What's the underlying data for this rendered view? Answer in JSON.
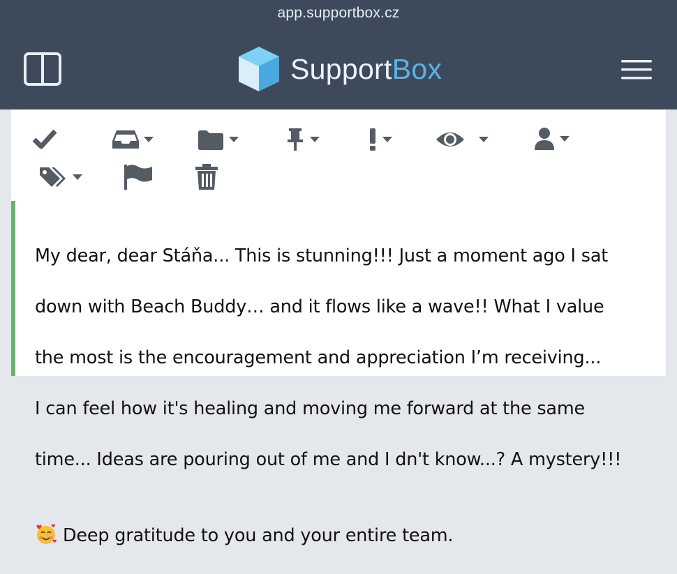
{
  "browser": {
    "url": "app.supportbox.cz"
  },
  "header": {
    "logo_prefix": "Support",
    "logo_suffix": "Box",
    "accent_color": "#5ab3e8",
    "bar_color": "#3c4a5c"
  },
  "toolbar": {
    "tools": [
      {
        "icon": "checkmark-icon"
      },
      {
        "icon": "inbox-icon"
      },
      {
        "icon": "folder-icon"
      },
      {
        "icon": "pin-icon"
      },
      {
        "icon": "priority-icon"
      },
      {
        "icon": "eye-icon"
      },
      {
        "icon": "user-icon"
      },
      {
        "icon": "tags-icon"
      },
      {
        "icon": "flag-icon"
      },
      {
        "icon": "trash-icon"
      }
    ]
  },
  "message": {
    "lines": [
      "My dear, dear Stáňa... This is stunning!!! Just a moment ago I sat",
      "down with Beach Buddy… and it flows like a wave!! What I value",
      "the most is the encouragement and appreciation I’m receiving...",
      "I can feel how it's healing and moving me forward at the same",
      "time... Ideas are pouring out of me and I dn't know...? A mystery!!!"
    ],
    "last_line": "Deep gratitude to you and your entire team.",
    "emoji": "smiling-face-with-hearts-emoji",
    "border_color": "#6ab06e"
  }
}
